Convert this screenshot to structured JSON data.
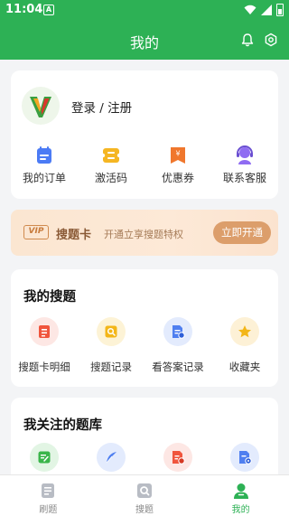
{
  "status_bar": {
    "time": "11:04",
    "notification_letter": "A"
  },
  "header": {
    "title": "我的"
  },
  "profile": {
    "login_label": "登录 / 注册"
  },
  "quick_actions": [
    {
      "label": "我的订单",
      "icon": "order-icon"
    },
    {
      "label": "激活码",
      "icon": "activation-code-icon"
    },
    {
      "label": "优惠券",
      "icon": "coupon-icon"
    },
    {
      "label": "联系客服",
      "icon": "customer-service-icon"
    }
  ],
  "vip_banner": {
    "badge": "VIP",
    "title": "搜题卡",
    "description": "开通立享搜题特权",
    "button_label": "立即开通"
  },
  "my_search": {
    "title": "我的搜题",
    "items": [
      {
        "label": "搜题卡明细",
        "icon": "card-detail-icon"
      },
      {
        "label": "搜题记录",
        "icon": "search-record-icon"
      },
      {
        "label": "看答案记录",
        "icon": "answer-record-icon"
      },
      {
        "label": "收藏夹",
        "icon": "star-icon"
      }
    ]
  },
  "question_bank": {
    "title": "我关注的题库",
    "items": [
      {
        "icon": "edit-note-icon"
      },
      {
        "icon": "feather-icon"
      },
      {
        "icon": "doc-time-icon"
      },
      {
        "icon": "doc-gear-icon"
      }
    ]
  },
  "bottom_nav": [
    {
      "label": "刷题",
      "icon": "practice-icon"
    },
    {
      "label": "搜题",
      "icon": "search-icon"
    },
    {
      "label": "我的",
      "icon": "profile-icon"
    }
  ],
  "colors": {
    "brand": "#2db155",
    "vip_accent": "#dc9e6b",
    "background": "#f3f4f6"
  }
}
